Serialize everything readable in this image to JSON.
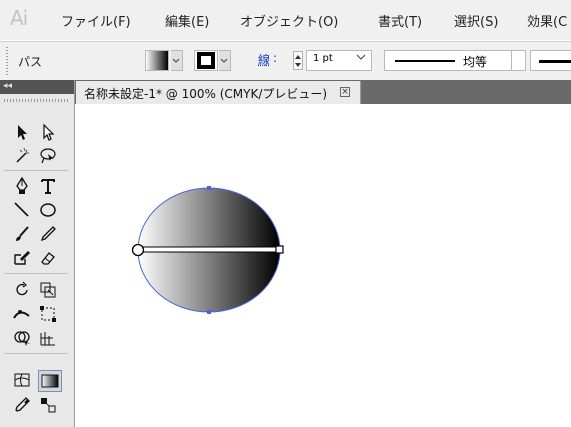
{
  "app": {
    "logo": "Ai"
  },
  "menu": [
    {
      "label": "ファイル(F)"
    },
    {
      "label": "編集(E)"
    },
    {
      "label": "オブジェクト(O)"
    },
    {
      "label": "書式(T)"
    },
    {
      "label": "選択(S)"
    },
    {
      "label": "効果(C"
    }
  ],
  "control": {
    "selection_label": "パス",
    "stroke_label": "線",
    "stroke_colon": ":",
    "stroke_weight": "1 pt",
    "profile_label": "均等"
  },
  "toolpanel": {
    "collapse_label": "◂◂"
  },
  "document": {
    "tab_title": "名称未設定-1* @ 100% (CMYK/プレビュー)",
    "close_glyph": "×"
  },
  "colors": {
    "selection": "#4a64d8",
    "gradient_start": "#ffffff",
    "gradient_end": "#000000",
    "link": "#1a3fbf"
  },
  "icons": [
    "selection-icon",
    "direct-selection-icon",
    "magic-wand-icon",
    "lasso-icon",
    "pen-icon",
    "type-icon",
    "line-segment-icon",
    "ellipse-icon",
    "paintbrush-icon",
    "pencil-icon",
    "blob-brush-icon",
    "eraser-icon",
    "rotate-icon",
    "scale-icon",
    "width-icon",
    "free-transform-icon",
    "shape-builder-icon",
    "perspective-grid-icon",
    "mesh-icon",
    "gradient-icon",
    "eyedropper-icon",
    "blend-icon"
  ]
}
